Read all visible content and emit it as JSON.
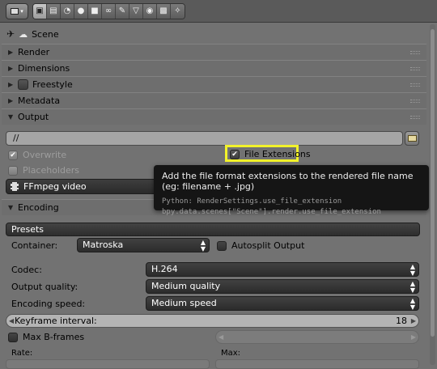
{
  "header": {
    "editor_type_icon": "properties-editor-icon",
    "tabs": [
      {
        "icon": "render-icon",
        "glyph": "▣",
        "active": true
      },
      {
        "icon": "render-layers-icon",
        "glyph": "▤",
        "active": false
      },
      {
        "icon": "scene-icon",
        "glyph": "◔",
        "active": false
      },
      {
        "icon": "world-icon",
        "glyph": "●",
        "active": false
      },
      {
        "icon": "object-icon",
        "glyph": "■",
        "active": false
      },
      {
        "icon": "constraints-icon",
        "glyph": "∞",
        "active": false
      },
      {
        "icon": "modifiers-icon",
        "glyph": "✎",
        "active": false
      },
      {
        "icon": "data-icon",
        "glyph": "▽",
        "active": false
      },
      {
        "icon": "material-icon",
        "glyph": "◉",
        "active": false
      },
      {
        "icon": "texture-icon",
        "glyph": "▩",
        "active": false
      },
      {
        "icon": "particles-icon",
        "glyph": "✧",
        "active": false
      }
    ]
  },
  "context": {
    "pin_icon": "pin-icon",
    "scene_label": "Scene"
  },
  "panels": {
    "render": "Render",
    "dimensions": "Dimensions",
    "freestyle": "Freestyle",
    "metadata": "Metadata",
    "output": "Output",
    "encoding": "Encoding"
  },
  "output": {
    "path": "//",
    "overwrite": "Overwrite",
    "file_extensions": "File Extensions",
    "placeholders": "Placeholders",
    "format": "FFmpeg video"
  },
  "tooltip": {
    "text": "Add the file format extensions to the rendered file name (eg: filename + .jpg)",
    "python_line1": "Python: RenderSettings.use_file_extension",
    "python_line2": "bpy.data.scenes[\"Scene\"].render.use_file_extension"
  },
  "encoding": {
    "presets": "Presets",
    "container_label": "Container:",
    "container_value": "Matroska",
    "autosplit": "Autosplit Output",
    "codec_label": "Codec:",
    "codec_value": "H.264",
    "quality_label": "Output quality:",
    "quality_value": "Medium quality",
    "speed_label": "Encoding speed:",
    "speed_value": "Medium speed",
    "keyframe_label": "Keyframe interval:",
    "keyframe_value": "18",
    "max_bframes": "Max B-frames",
    "rate_label": "Rate:",
    "max_label": "Max:"
  },
  "colors": {
    "highlight": "#f2f22a",
    "tooltip_bg": "#151515",
    "panel_bg": "#727272"
  }
}
